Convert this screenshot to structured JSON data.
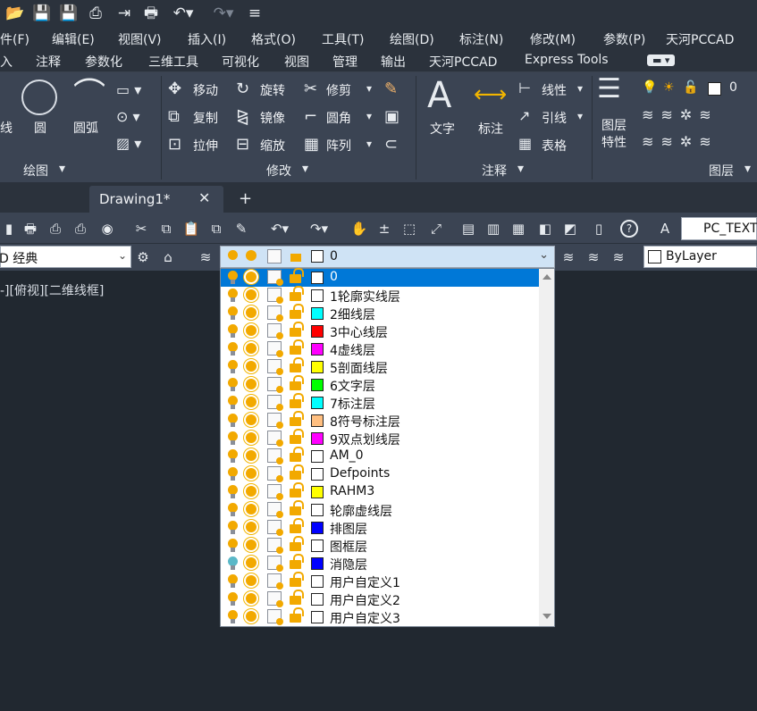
{
  "quick_access": {
    "icons": [
      "open-folder-icon",
      "save-icon",
      "save-as-icon",
      "plot-icon",
      "import-icon",
      "print-icon",
      "undo-icon",
      "redo-icon",
      "customize-icon"
    ]
  },
  "menubar": {
    "items": [
      "件(F)",
      "编辑(E)",
      "视图(V)",
      "插入(I)",
      "格式(O)",
      "工具(T)",
      "绘图(D)",
      "标注(N)",
      "修改(M)",
      "参数(P)",
      "天河PCCAD"
    ]
  },
  "ribbon_tabs": {
    "items": [
      "入",
      "注释",
      "参数化",
      "三维工具",
      "可视化",
      "视图",
      "管理",
      "输出",
      "天河PCCAD",
      "Express Tools"
    ]
  },
  "ribbon": {
    "draw": {
      "line": "线",
      "circle": "圆",
      "arc": "圆弧",
      "title": "绘图"
    },
    "modify": {
      "move": "移动",
      "rotate": "旋转",
      "trim": "修剪",
      "copy": "复制",
      "mirror": "镜像",
      "fillet": "圆角",
      "stretch": "拉伸",
      "scale": "缩放",
      "array": "阵列",
      "title": "修改"
    },
    "annotation": {
      "text": "文字",
      "dimension": "标注",
      "linear": "线性",
      "leader": "引线",
      "table": "表格",
      "title": "注释"
    },
    "layers": {
      "properties": "图层\n特性",
      "current": "0",
      "title": "图层"
    }
  },
  "document": {
    "tab": "Drawing1*",
    "new_tab": "+"
  },
  "toolbar": {
    "text_style": "PC_TEXT"
  },
  "workspace": {
    "value": "D 经典"
  },
  "layer_combo": {
    "value": "0"
  },
  "color_combo": {
    "value": "ByLayer"
  },
  "viewport_label": "-][俯视][二维线框]",
  "layers": [
    {
      "name": "0",
      "color": "#ffffff",
      "bulb": "#f2a900",
      "selected": true
    },
    {
      "name": "1轮廓实线层",
      "color": "#ffffff",
      "bulb": "#f2a900"
    },
    {
      "name": "2细线层",
      "color": "#00ffff",
      "bulb": "#f2a900"
    },
    {
      "name": "3中心线层",
      "color": "#ff0000",
      "bulb": "#f2a900"
    },
    {
      "name": "4虚线层",
      "color": "#ff00ff",
      "bulb": "#f2a900"
    },
    {
      "name": "5剖面线层",
      "color": "#ffff00",
      "bulb": "#f2a900"
    },
    {
      "name": "6文字层",
      "color": "#00ff00",
      "bulb": "#f2a900"
    },
    {
      "name": "7标注层",
      "color": "#00ffff",
      "bulb": "#f2a900"
    },
    {
      "name": "8符号标注层",
      "color": "#ffbf80",
      "bulb": "#f2a900"
    },
    {
      "name": "9双点划线层",
      "color": "#ff00ff",
      "bulb": "#f2a900"
    },
    {
      "name": "AM_0",
      "color": "#ffffff",
      "bulb": "#f2a900"
    },
    {
      "name": "Defpoints",
      "color": "#ffffff",
      "bulb": "#f2a900"
    },
    {
      "name": "RAHM3",
      "color": "#ffff00",
      "bulb": "#f2a900"
    },
    {
      "name": "轮廓虚线层",
      "color": "#ffffff",
      "bulb": "#f2a900"
    },
    {
      "name": "排图层",
      "color": "#0000ff",
      "bulb": "#f2a900"
    },
    {
      "name": "图框层",
      "color": "#ffffff",
      "bulb": "#f2a900"
    },
    {
      "name": "消隐层",
      "color": "#0000ff",
      "bulb": "#5ab8c8"
    },
    {
      "name": "用户自定义1",
      "color": "#ffffff",
      "bulb": "#f2a900"
    },
    {
      "name": "用户自定义2",
      "color": "#ffffff",
      "bulb": "#f2a900"
    },
    {
      "name": "用户自定义3",
      "color": "#ffffff",
      "bulb": "#f2a900"
    }
  ]
}
